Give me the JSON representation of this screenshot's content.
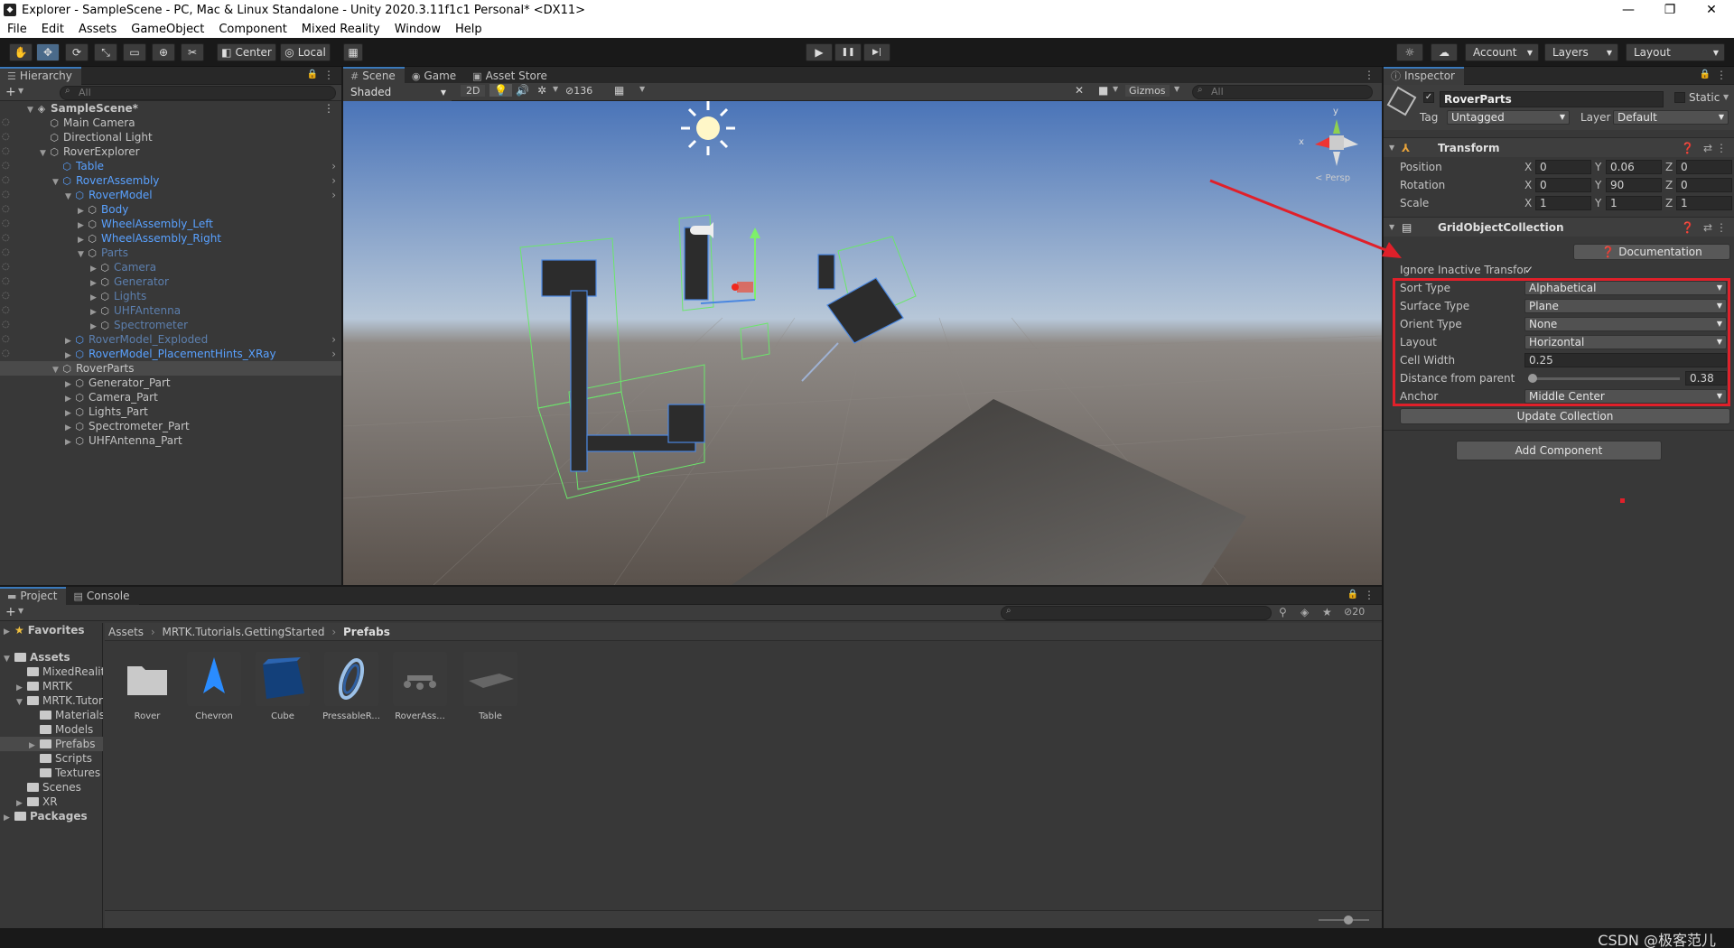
{
  "window": {
    "title": "Explorer - SampleScene - PC, Mac & Linux Standalone - Unity 2020.3.11f1c1 Personal* <DX11>",
    "minimize": "—",
    "maximize": "❐",
    "close": "✕"
  },
  "menu": [
    "File",
    "Edit",
    "Assets",
    "GameObject",
    "Component",
    "Mixed Reality",
    "Window",
    "Help"
  ],
  "toolbar": {
    "pivot": "Center",
    "space": "Local",
    "play": "▶",
    "pause": "❚❚",
    "step": "▶|",
    "account": "Account",
    "layers": "Layers",
    "layout": "Layout"
  },
  "hierarchy": {
    "tab": "Hierarchy",
    "search_placeholder": "All",
    "add": "+",
    "rows": [
      {
        "label": "SampleScene*",
        "depth": 0,
        "icon": "unity-icon",
        "style": "bold",
        "arrow": "▼"
      },
      {
        "label": "Main Camera",
        "depth": 1,
        "icon": "cube-icon",
        "style": "normal",
        "arrow": ""
      },
      {
        "label": "Directional Light",
        "depth": 1,
        "icon": "cube-icon",
        "style": "normal",
        "arrow": ""
      },
      {
        "label": "RoverExplorer",
        "depth": 1,
        "icon": "cube-icon",
        "style": "normal",
        "arrow": "▼"
      },
      {
        "label": "Table",
        "depth": 2,
        "icon": "prefab-icon",
        "style": "blue",
        "arrow": ""
      },
      {
        "label": "RoverAssembly",
        "depth": 2,
        "icon": "prefab-icon",
        "style": "blue",
        "arrow": "▼"
      },
      {
        "label": "RoverModel",
        "depth": 3,
        "icon": "prefab-icon",
        "style": "blue",
        "arrow": "▼"
      },
      {
        "label": "Body",
        "depth": 4,
        "icon": "cube-icon",
        "style": "blue",
        "arrow": "▶"
      },
      {
        "label": "WheelAssembly_Left",
        "depth": 4,
        "icon": "cube-icon",
        "style": "blue",
        "arrow": "▶"
      },
      {
        "label": "WheelAssembly_Right",
        "depth": 4,
        "icon": "cube-icon",
        "style": "blue",
        "arrow": "▶"
      },
      {
        "label": "Parts",
        "depth": 4,
        "icon": "cube-icon",
        "style": "dim",
        "arrow": "▼"
      },
      {
        "label": "Camera",
        "depth": 5,
        "icon": "cube-icon",
        "style": "dim",
        "arrow": "▶"
      },
      {
        "label": "Generator",
        "depth": 5,
        "icon": "cube-icon",
        "style": "dim",
        "arrow": "▶"
      },
      {
        "label": "Lights",
        "depth": 5,
        "icon": "cube-icon",
        "style": "dim",
        "arrow": "▶"
      },
      {
        "label": "UHFAntenna",
        "depth": 5,
        "icon": "cube-icon",
        "style": "dim",
        "arrow": "▶"
      },
      {
        "label": "Spectrometer",
        "depth": 5,
        "icon": "cube-icon",
        "style": "dim",
        "arrow": "▶"
      },
      {
        "label": "RoverModel_Exploded",
        "depth": 3,
        "icon": "prefab-icon",
        "style": "dim",
        "arrow": "▶"
      },
      {
        "label": "RoverModel_PlacementHints_XRay",
        "depth": 3,
        "icon": "prefab-icon",
        "style": "blue",
        "arrow": "▶"
      },
      {
        "label": "RoverParts",
        "depth": 2,
        "icon": "cube-icon",
        "style": "selected",
        "arrow": "▼"
      },
      {
        "label": "Generator_Part",
        "depth": 3,
        "icon": "cube-icon",
        "style": "normal",
        "arrow": "▶"
      },
      {
        "label": "Camera_Part",
        "depth": 3,
        "icon": "cube-icon",
        "style": "normal",
        "arrow": "▶"
      },
      {
        "label": "Lights_Part",
        "depth": 3,
        "icon": "cube-icon",
        "style": "normal",
        "arrow": "▶"
      },
      {
        "label": "Spectrometer_Part",
        "depth": 3,
        "icon": "cube-icon",
        "style": "normal",
        "arrow": "▶"
      },
      {
        "label": "UHFAntenna_Part",
        "depth": 3,
        "icon": "cube-icon",
        "style": "normal",
        "arrow": "▶"
      }
    ]
  },
  "scene": {
    "tabs": [
      "Scene",
      "Game",
      "Asset Store"
    ],
    "shading": "Shaded",
    "mode2d": "2D",
    "hidden_count": "136",
    "gizmos": "Gizmos",
    "search_placeholder": "All",
    "gizmo_axis_y": "y",
    "gizmo_axis_x": "x",
    "persp": "< Persp"
  },
  "inspector": {
    "tab": "Inspector",
    "object_name": "RoverParts",
    "static_label": "Static",
    "tag_label": "Tag",
    "tag_value": "Untagged",
    "layer_label": "Layer",
    "layer_value": "Default",
    "transform": {
      "title": "Transform",
      "position_label": "Position",
      "rotation_label": "Rotation",
      "scale_label": "Scale",
      "position": {
        "x": "0",
        "y": "0.06",
        "z": "0"
      },
      "rotation": {
        "x": "0",
        "y": "90",
        "z": "0"
      },
      "scale": {
        "x": "1",
        "y": "1",
        "z": "1"
      }
    },
    "grid": {
      "title": "GridObjectCollection",
      "documentation": "Documentation",
      "ignore_inactive_label": "Ignore Inactive Transfor",
      "sort_type_label": "Sort Type",
      "sort_type": "Alphabetical",
      "surface_type_label": "Surface Type",
      "surface_type": "Plane",
      "orient_type_label": "Orient Type",
      "orient_type": "None",
      "layout_label": "Layout",
      "layout": "Horizontal",
      "cell_width_label": "Cell Width",
      "cell_width": "0.25",
      "distance_label": "Distance from parent",
      "distance": "0.38",
      "distance_fraction": 0.0,
      "anchor_label": "Anchor",
      "anchor": "Middle Center",
      "update_button": "Update Collection"
    },
    "add_component": "Add Component"
  },
  "project": {
    "tabs": [
      "Project",
      "Console"
    ],
    "add": "+",
    "hidden_count": "20",
    "breadcrumb": [
      "Assets",
      "MRTK.Tutorials.GettingStarted",
      "Prefabs"
    ],
    "tree": [
      {
        "label": "Favorites",
        "depth": 0,
        "arrow": "▶",
        "icon": "star",
        "bold": true
      },
      {
        "label": "Assets",
        "depth": 0,
        "arrow": "▼",
        "icon": "folder",
        "bold": true
      },
      {
        "label": "MixedRealit",
        "depth": 1,
        "arrow": "",
        "icon": "folder",
        "bold": false
      },
      {
        "label": "MRTK",
        "depth": 1,
        "arrow": "▶",
        "icon": "folder",
        "bold": false
      },
      {
        "label": "MRTK.Tutori",
        "depth": 1,
        "arrow": "▼",
        "icon": "folder",
        "bold": false
      },
      {
        "label": "Materials",
        "depth": 2,
        "arrow": "",
        "icon": "folder",
        "bold": false
      },
      {
        "label": "Models",
        "depth": 2,
        "arrow": "",
        "icon": "folder",
        "bold": false
      },
      {
        "label": "Prefabs",
        "depth": 2,
        "arrow": "▶",
        "icon": "folder",
        "bold": false,
        "selected": true
      },
      {
        "label": "Scripts",
        "depth": 2,
        "arrow": "",
        "icon": "folder",
        "bold": false
      },
      {
        "label": "Textures",
        "depth": 2,
        "arrow": "",
        "icon": "folder",
        "bold": false
      },
      {
        "label": "Scenes",
        "depth": 1,
        "arrow": "",
        "icon": "folder",
        "bold": false
      },
      {
        "label": "XR",
        "depth": 1,
        "arrow": "▶",
        "icon": "folder",
        "bold": false
      },
      {
        "label": "Packages",
        "depth": 0,
        "arrow": "▶",
        "icon": "folder",
        "bold": true
      }
    ],
    "assets": [
      {
        "label": "Rover",
        "kind": "folder"
      },
      {
        "label": "Chevron",
        "kind": "chevron"
      },
      {
        "label": "Cube",
        "kind": "cube"
      },
      {
        "label": "PressableR...",
        "kind": "pressable"
      },
      {
        "label": "RoverAss...",
        "kind": "rover"
      },
      {
        "label": "Table",
        "kind": "table"
      }
    ]
  },
  "watermark": "CSDN @极客范儿",
  "colors": {
    "accent": "#3a79bb",
    "highlight": "#e0202a",
    "prefab_blue": "#59a1ff"
  }
}
